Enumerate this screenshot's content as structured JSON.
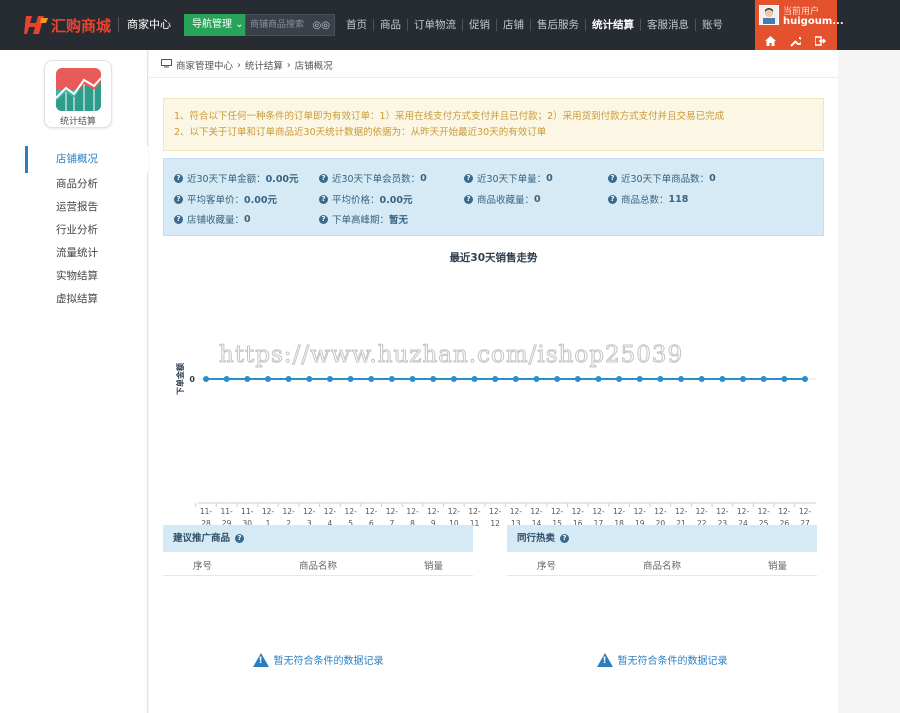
{
  "header": {
    "logo_text": "汇购商城",
    "center_title": "商家中心",
    "nav_manage": "导航管理",
    "search_placeholder": "商铺商品搜索",
    "nav": [
      "首页",
      "商品",
      "订单物流",
      "促销",
      "店铺",
      "售后服务",
      "统计结算",
      "客服消息",
      "账号"
    ],
    "active_nav": "统计结算",
    "user_label": "当前用户",
    "user_name": "huigoum...",
    "accent": "#e3522d",
    "bar_color": "#272c33"
  },
  "sidebar": {
    "app_label": "统计结算",
    "items": [
      "店铺概况",
      "商品分析",
      "运营报告",
      "行业分析",
      "流量统计",
      "实物结算",
      "虚拟结算"
    ],
    "active": "店铺概况"
  },
  "breadcrumb": [
    "商家管理中心",
    "统计结算",
    "店铺概况"
  ],
  "notice": {
    "line1": "1、符合以下任何一种条件的订单即为有效订单：1）采用在线支付方式支付并且已付款；2）采用货到付款方式支付并且交易已完成",
    "line2": "2、以下关于订单和订单商品近30天统计数据的依据为：从昨天开始最近30天的有效订单"
  },
  "stats": [
    {
      "label": "近30天下单金额：",
      "value": "0.00元"
    },
    {
      "label": "近30天下单会员数：",
      "value": "0"
    },
    {
      "label": "近30天下单量：",
      "value": "0"
    },
    {
      "label": "近30天下单商品数：",
      "value": "0"
    },
    {
      "label": "平均客单价：",
      "value": "0.00元"
    },
    {
      "label": "平均价格：",
      "value": "0.00元"
    },
    {
      "label": "商品收藏量：",
      "value": "0"
    },
    {
      "label": "商品总数：",
      "value": "118"
    },
    {
      "label": "店铺收藏量：",
      "value": "0"
    },
    {
      "label": "下单高峰期：",
      "value": "暂无"
    }
  ],
  "watermark": "https://www.huzhan.com/ishop25039",
  "chart_data": {
    "type": "line",
    "title": "最近30天销售走势",
    "ylabel": "下单金额",
    "y_ticks": [
      "0"
    ],
    "categories": [
      "11-28",
      "11-29",
      "11-30",
      "12-1",
      "12-2",
      "12-3",
      "12-4",
      "12-5",
      "12-6",
      "12-7",
      "12-8",
      "12-9",
      "12-10",
      "12-11",
      "12-12",
      "12-13",
      "12-14",
      "12-15",
      "12-16",
      "12-17",
      "12-18",
      "12-19",
      "12-20",
      "12-21",
      "12-22",
      "12-23",
      "12-24",
      "12-25",
      "12-26",
      "12-27"
    ],
    "values": [
      0,
      0,
      0,
      0,
      0,
      0,
      0,
      0,
      0,
      0,
      0,
      0,
      0,
      0,
      0,
      0,
      0,
      0,
      0,
      0,
      0,
      0,
      0,
      0,
      0,
      0,
      0,
      0,
      0,
      0
    ],
    "color": "#2a8fc9"
  },
  "panels": [
    {
      "title": "建议推广商品",
      "cols": [
        "序号",
        "商品名称",
        "销量"
      ],
      "empty": "暂无符合条件的数据记录"
    },
    {
      "title": "同行热卖",
      "cols": [
        "序号",
        "商品名称",
        "销量"
      ],
      "empty": "暂无符合条件的数据记录"
    }
  ]
}
